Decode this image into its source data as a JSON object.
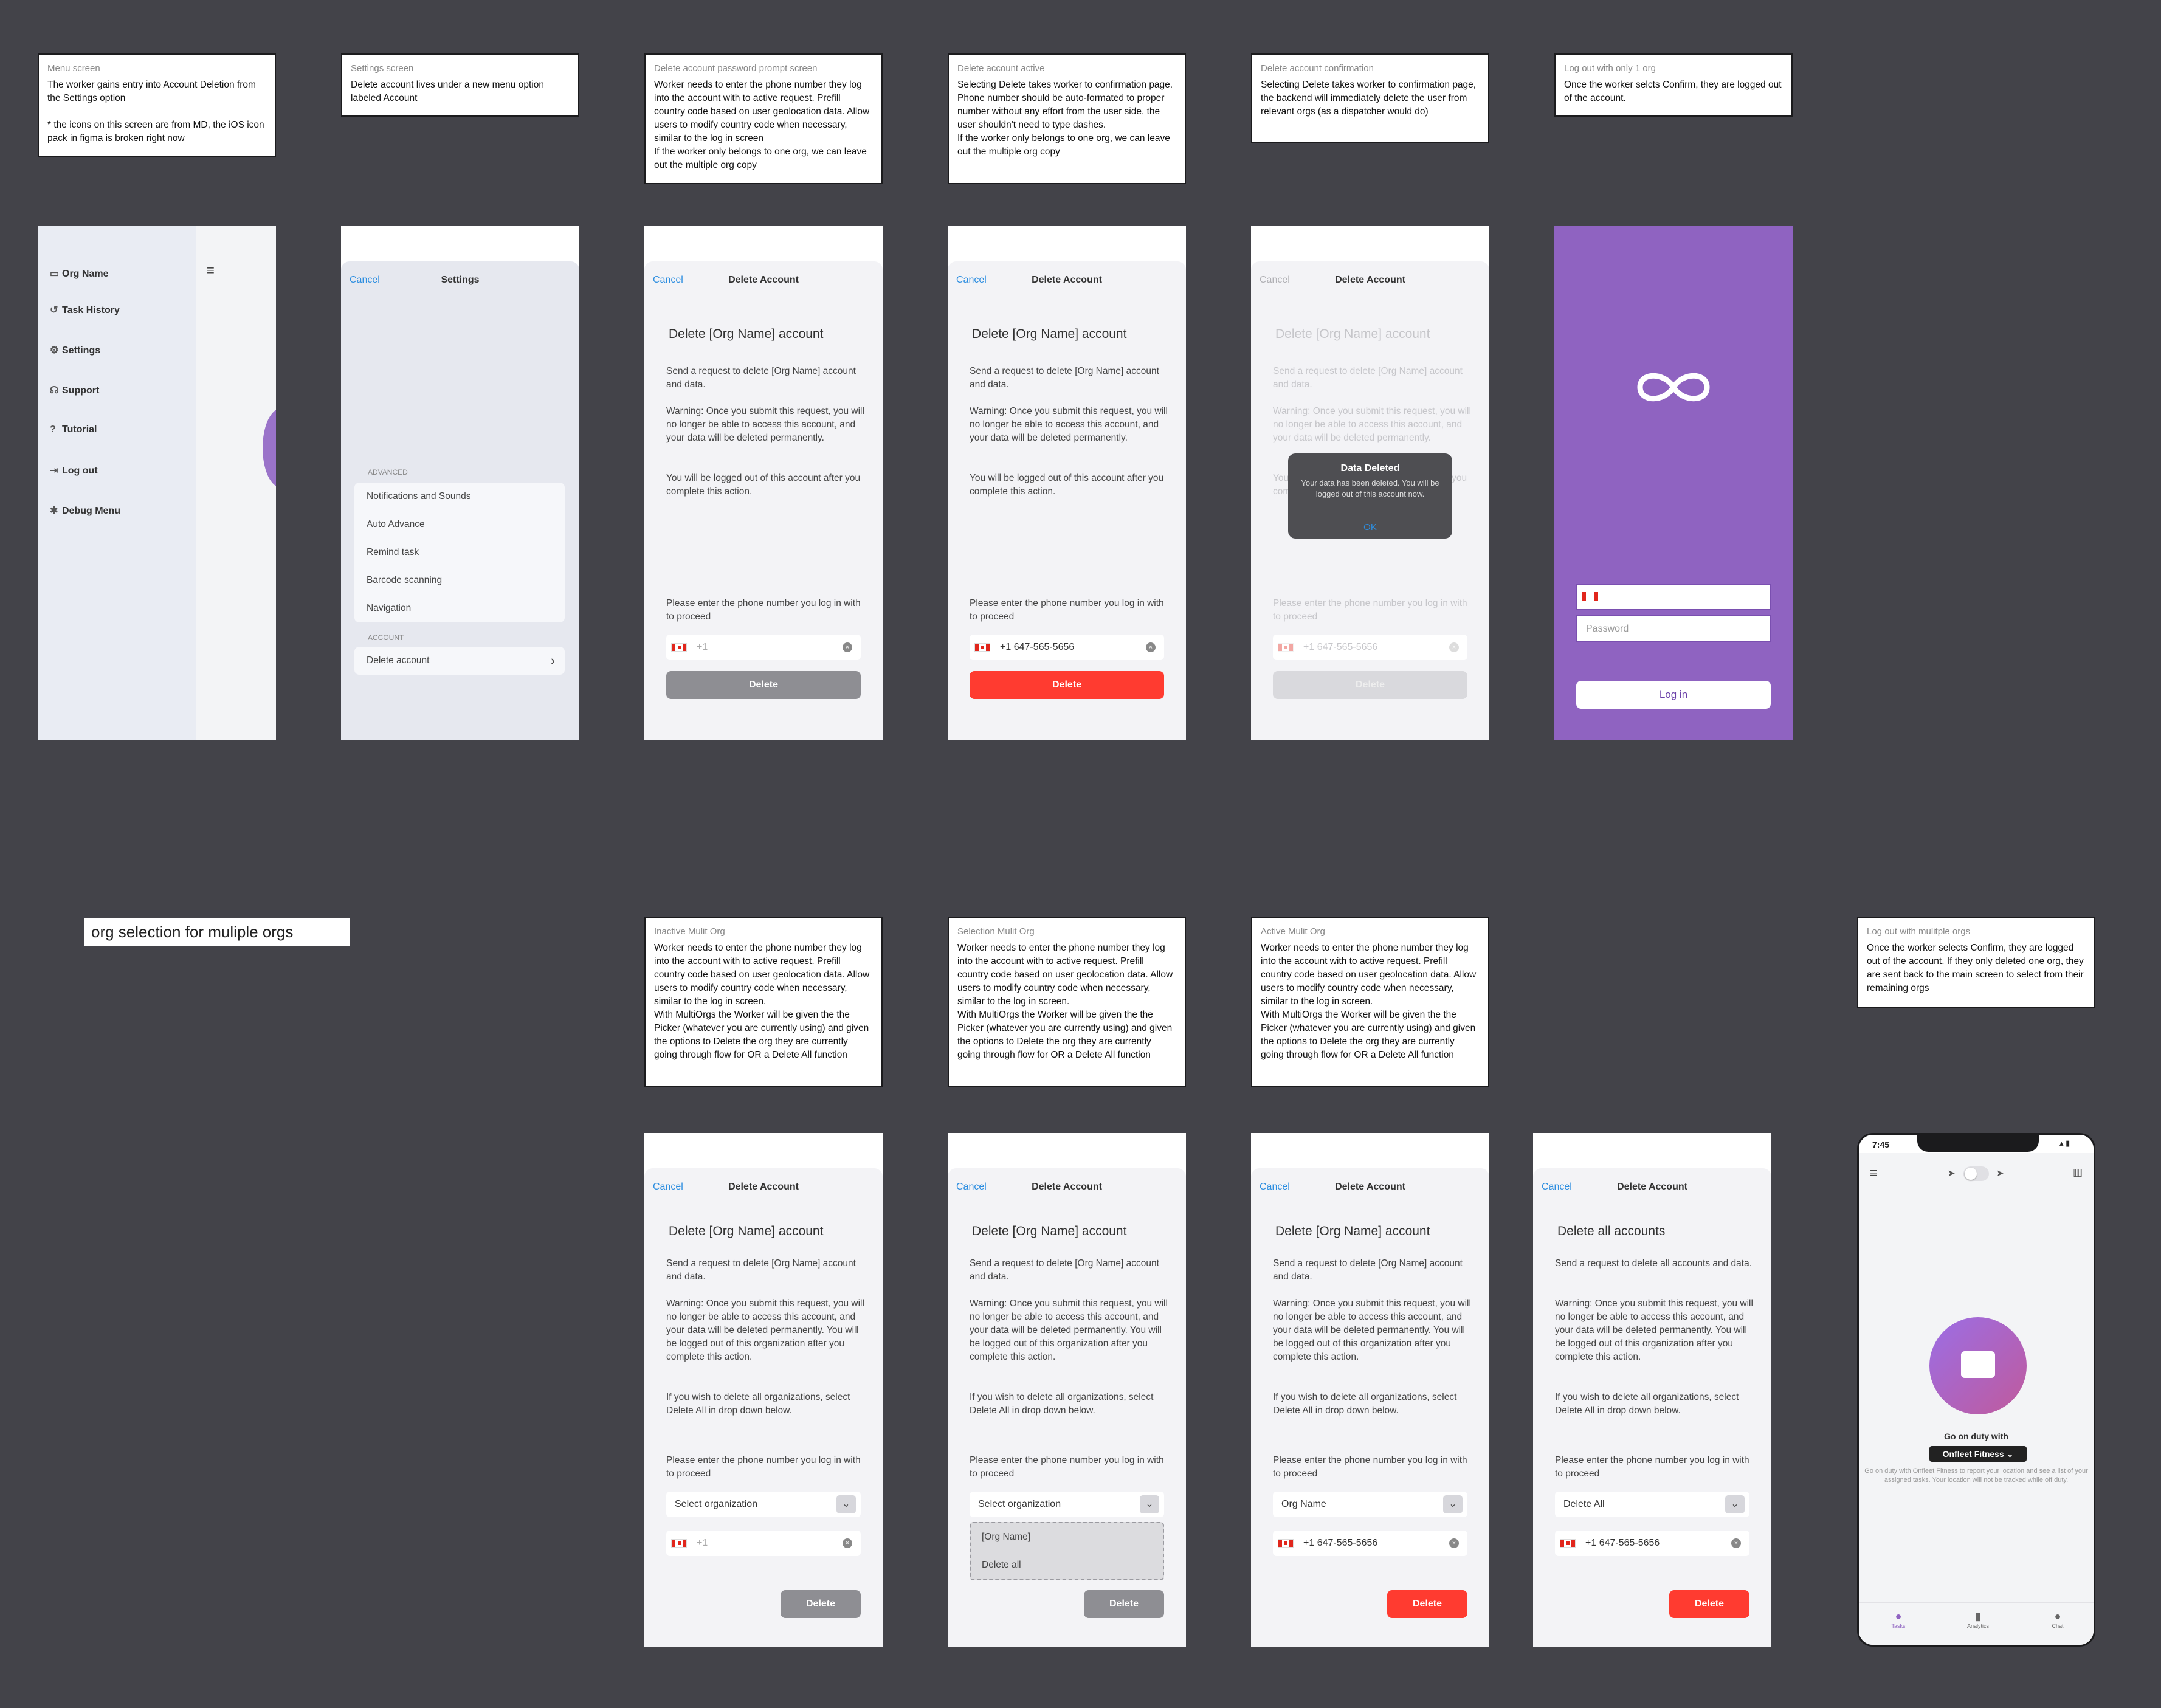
{
  "notes": [
    {
      "title": "Menu screen",
      "body": "The worker gains entry into Account Deletion from the Settings option\n\n* the icons on this screen are from MD, the iOS icon pack in figma is broken right now"
    },
    {
      "title": "Settings screen",
      "body": "Delete account lives under a new menu option labeled Account"
    },
    {
      "title": "Delete account password prompt screen",
      "body": "Worker needs to enter the phone number they log into the account with to active request. Prefill country code based on user geolocation data. Allow users to modify country code when necessary, similar to the log in screen\nIf the worker only belongs to one org, we can leave out the multiple org copy"
    },
    {
      "title": "Delete account active",
      "body": "Selecting Delete takes worker to confirmation page. Phone number  should be auto-formated to proper number without any effort from the user side, the user shouldn't need to type dashes.\nIf the worker only belongs to one org, we can leave out the multiple org copy"
    },
    {
      "title": "Delete account confirmation",
      "body": "Selecting Delete takes worker to confirmation page, the backend will immediately delete the user from relevant orgs (as a dispatcher would do)"
    },
    {
      "title": "Log out with only 1 org",
      "body": "Once the worker selcts Confirm, they are logged out of the account."
    },
    {
      "title": "Inactive Mulit Org",
      "body": "Worker needs to enter the phone number they log into the account with to active request. Prefill country code based on user geolocation data. Allow users to modify country code when necessary, similar to the log in screen.\nWith MultiOrgs the Worker will be given the the Picker (whatever you are currently using) and given the options to Delete the org they are currently going through flow for OR a Delete All function"
    },
    {
      "title": "Selection Mulit Org",
      "body": "Worker needs to enter the phone number they log into the account with to active request. Prefill country code based on user geolocation data. Allow users to modify country code when necessary, similar to the log in screen.\nWith MultiOrgs the Worker will be given the the Picker (whatever you are currently using) and given the options to Delete the org they are currently going through flow for OR a Delete All function"
    },
    {
      "title": "Active Mulit Org",
      "body": "Worker needs to enter the phone number they log into the account with to active request. Prefill country code based on user geolocation data. Allow users to modify country code when necessary, similar to the log in screen.\nWith MultiOrgs the Worker will be given the the Picker (whatever you are currently using) and given the options to Delete the org they are currently going through flow for OR a Delete All function"
    },
    {
      "title": "Log out with mulitple orgs",
      "body": "Once the worker selects Confirm, they are logged out of the account. If they only deleted one org, they are sent back to the main screen to select from their remaining orgs"
    }
  ],
  "section_label": "org selection for muliple orgs",
  "menu": {
    "items": [
      "Org Name",
      "Task History",
      "Settings",
      "Support",
      "Tutorial",
      "Log out",
      "Debug Menu"
    ]
  },
  "settings": {
    "cancel": "Cancel",
    "title": "Settings",
    "advanced_header": "ADVANCED",
    "advanced_items": [
      "Notifications and Sounds",
      "Auto Advance",
      "Remind task",
      "Barcode scanning",
      "Navigation"
    ],
    "account_header": "ACCOUNT",
    "delete_account": "Delete account"
  },
  "delete": {
    "cancel": "Cancel",
    "title": "Delete Account",
    "heading": "Delete [Org Name] account",
    "intro": "Send a request to delete [Org Name] account and data.",
    "warning": "Warning: Once you submit this request, you will no longer be able to access this account, and your data will be deleted permanently.",
    "logout_note": "You will be logged out of this account after you complete this action.",
    "prompt": "Please enter the phone number you log in with to proceed",
    "phone_placeholder": "+1",
    "phone_value": "+1 647-565-5656",
    "button": "Delete"
  },
  "alert": {
    "title": "Data Deleted",
    "body": "Your data has been deleted. You will be logged out of this account now.",
    "ok": "OK"
  },
  "login": {
    "phone_placeholder": "",
    "password_placeholder": "Password",
    "button": "Log in"
  },
  "multi": {
    "warning": "Warning: Once you submit this request, you will no longer be able to access this account, and your data will be deleted permanently. You will be logged out of this organization after you complete this action.",
    "delete_all_note": "If you wish to delete all organizations, select Delete All in drop down below.",
    "select_placeholder": "Select organization",
    "options": [
      "[Org Name]",
      "Delete all"
    ],
    "org_name": "Org Name",
    "phone_value": "+1  647-565-5656",
    "all_heading": "Delete all accounts",
    "all_intro": "Send a request to delete all accounts and data.",
    "all_selected": "Delete All"
  },
  "home": {
    "time": "7:45",
    "duty_label": "Go on duty with",
    "org": "Onfleet Fitness",
    "duty_desc": "Go on duty with Onfleet Fitness to report your location and see a list of your assigned tasks. Your location will not be tracked while off duty.",
    "tabs": [
      "Tasks",
      "Analytics",
      "Chat"
    ]
  },
  "colors": {
    "background": "#434349",
    "accent_blue": "#2d8ee0",
    "danger_red": "#ff3b30",
    "brand_purple": "#8f63c1"
  }
}
